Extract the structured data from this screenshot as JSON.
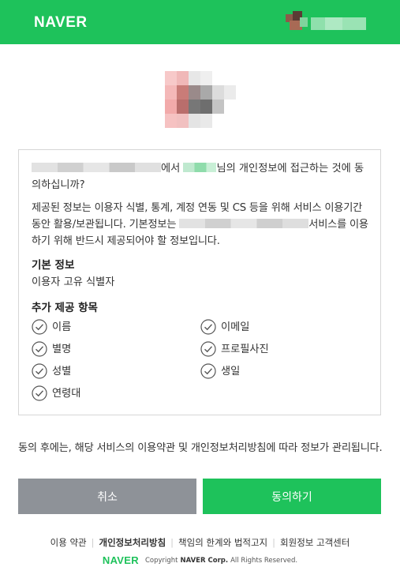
{
  "header": {
    "brand": "NAVER",
    "user_avatar_icon": "user-avatar-blurred"
  },
  "app": {
    "logo_icon": "app-logo-blurred"
  },
  "consent": {
    "intro_mid": "에서 ",
    "intro_end": "님의 개인정보에 접근하는 것에 동의하십니까?",
    "desc_start": "제공된 정보는 이용자 식별, 통계, 계정 연동 및 CS 등을 위해 서비스 이용기간 동안 활용/보관됩니다. 기본정보는 ",
    "desc_end": "서비스를 이용하기 위해 반드시 제공되어야 할 정보입니다.",
    "basic_title": "기본 정보",
    "basic_item": "이용자 고유 식별자",
    "extra_title": "추가 제공 항목",
    "extra_items": [
      "이름",
      "이메일",
      "별명",
      "프로필사진",
      "성별",
      "생일",
      "연령대"
    ],
    "check_icon": "check-circle-icon"
  },
  "notice": "동의 후에는, 해당 서비스의 이용약관 및 개인정보처리방침에 따라 정보가 관리됩니다.",
  "buttons": {
    "cancel": "취소",
    "agree": "동의하기"
  },
  "footer": {
    "links": [
      "이용 약관",
      "개인정보처리방침",
      "책임의 한계와 법적고지",
      "회원정보 고객센터"
    ],
    "logo": "NAVER",
    "copyright_prefix": "Copyright",
    "copyright_corp": "NAVER Corp.",
    "copyright_suffix": "All Rights Reserved."
  },
  "colors": {
    "brand_green": "#1ec25b",
    "cancel_gray": "#8e9298",
    "border": "#d6d6d6"
  }
}
